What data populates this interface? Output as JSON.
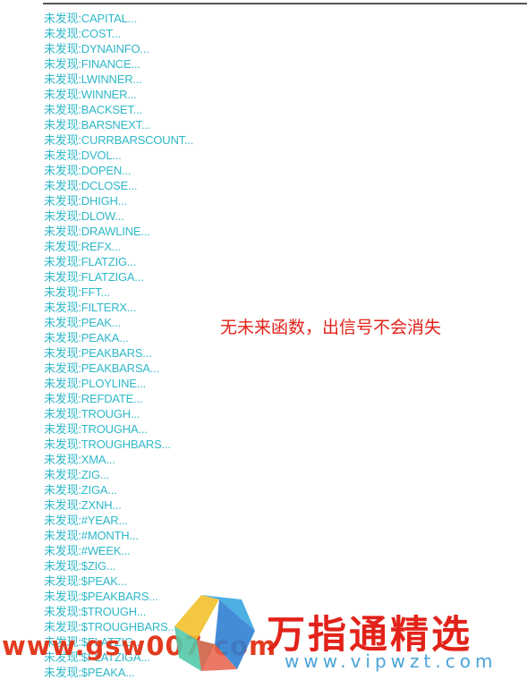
{
  "results": [
    "未发现:CAPITAL...",
    "未发现:COST...",
    "未发现:DYNAINFO...",
    "未发现:FINANCE...",
    "未发现:LWINNER...",
    "未发现:WINNER...",
    "未发现:BACKSET...",
    "未发现:BARSNEXT...",
    "未发现:CURRBARSCOUNT...",
    "未发现:DVOL...",
    "未发现:DOPEN...",
    "未发现:DCLOSE...",
    "未发现:DHIGH...",
    "未发现:DLOW...",
    "未发现:DRAWLINE...",
    "未发现:REFX...",
    "未发现:FLATZIG...",
    "未发现:FLATZIGA...",
    "未发现:FFT...",
    "未发现:FILTERX...",
    "未发现:PEAK...",
    "未发现:PEAKA...",
    "未发现:PEAKBARS...",
    "未发现:PEAKBARSA...",
    "未发现:PLOYLINE...",
    "未发现:REFDATE...",
    "未发现:TROUGH...",
    "未发现:TROUGHA...",
    "未发现:TROUGHBARS...",
    "未发现:XMA...",
    "未发现:ZIG...",
    "未发现:ZIGA...",
    "未发现:ZXNH...",
    "未发现:#YEAR...",
    "未发现:#MONTH...",
    "未发现:#WEEK...",
    "未发现:$ZIG...",
    "未发现:$PEAK...",
    "未发现:$PEAKBARS...",
    "未发现:$TROUGH...",
    "未发现:$TROUGHBARS...",
    "未发现:$FLATZIG...",
    "未发现:$FLATZIGA...",
    "未发现:$PEAKA..."
  ],
  "note": "无未来函数，出信号不会消失",
  "watermark": {
    "left_text": "www.gsw007.com",
    "title": "万指通精选",
    "url": "www.vipwzt.com"
  },
  "colors": {
    "result_text": "#2fb8c8",
    "note_text": "#e2231a",
    "watermark_red": "#e2231a",
    "watermark_blue": "#4aa3d8"
  }
}
